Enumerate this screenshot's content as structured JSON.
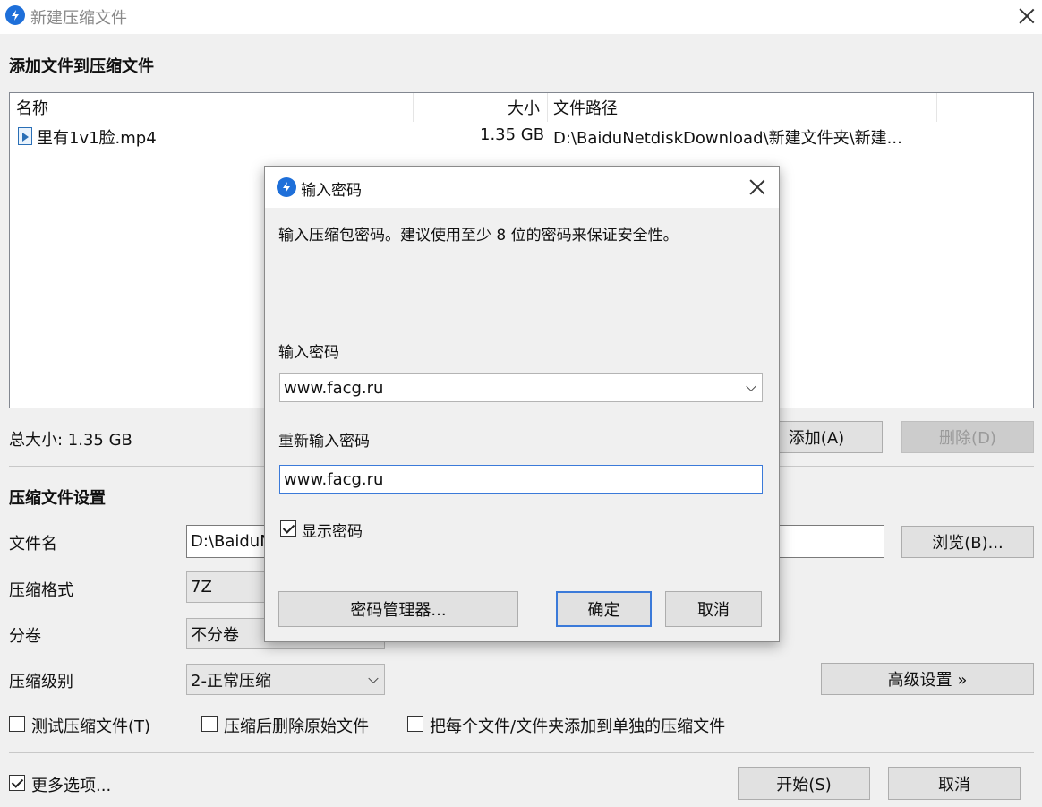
{
  "window": {
    "title": "新建压缩文件"
  },
  "section_add": {
    "heading": "添加文件到压缩文件"
  },
  "file_list": {
    "columns": [
      "名称",
      "大小",
      "文件路径"
    ],
    "rows": [
      {
        "name": "里有1v1脸.mp4",
        "size": "1.35 GB",
        "path": "D:\\BaiduNetdiskDownload\\新建文件夹\\新建..."
      }
    ]
  },
  "summary": {
    "total_size": "总大小: 1.35 GB",
    "add_button": "添加(A)",
    "delete_button": "删除(D)"
  },
  "settings": {
    "heading": "压缩文件设置",
    "filename_label": "文件名",
    "filename_value": "D:\\BaiduN",
    "browse_button": "浏览(B)...",
    "format_label": "压缩格式",
    "format_value": "7Z",
    "volume_label": "分卷",
    "volume_value": "不分卷",
    "level_label": "压缩级别",
    "level_value": "2-正常压缩",
    "advanced_button": "高级设置 »",
    "test_checkbox": "测试压缩文件(T)",
    "delete_source_checkbox": "压缩后删除原始文件",
    "separate_checkbox": "把每个文件/文件夹添加到单独的压缩文件"
  },
  "footer": {
    "more_options": "更多选项...",
    "start_button": "开始(S)",
    "cancel_button": "取消"
  },
  "dialog": {
    "title": "输入密码",
    "description": "输入压缩包密码。建议使用至少 8 位的密码来保证安全性。",
    "password_label": "输入密码",
    "password_value": "www.facg.ru",
    "confirm_label": "重新输入密码",
    "confirm_value": "www.facg.ru",
    "show_password": "显示密码",
    "manager_button": "密码管理器...",
    "ok_button": "确定",
    "cancel_button": "取消"
  },
  "colors": {
    "accent": "#1e6fd9",
    "focus_border": "#3b7ad9"
  }
}
